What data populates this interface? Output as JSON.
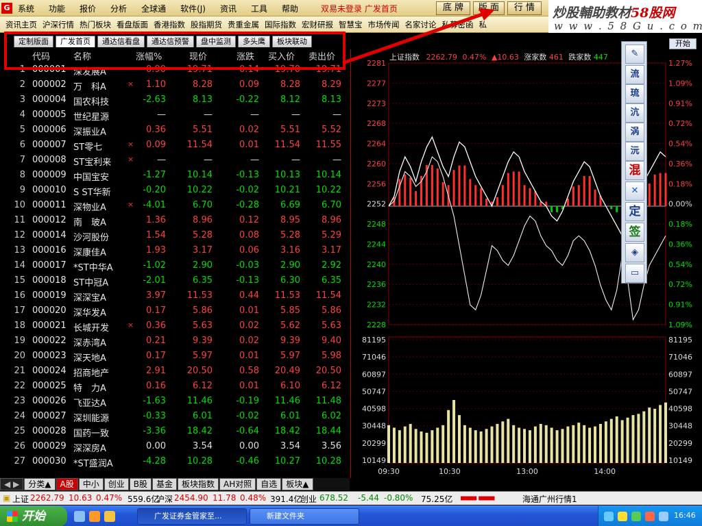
{
  "menubar": {
    "items": [
      "系统",
      "功能",
      "报价",
      "分析",
      "全球通",
      "软件(J)",
      "资讯",
      "工具",
      "帮助"
    ],
    "login_status": "双易未登录 广发首页",
    "buttons": [
      "底 牌",
      "版 面",
      "行 情"
    ]
  },
  "brand": {
    "line1_prefix": "炒股輔助教材",
    "line1_suffix": "58股网",
    "line2": "w w w . 5 8 G u . c o m"
  },
  "linkbar": {
    "items": [
      "资讯主页",
      "沪深行情",
      "热门板块",
      "看盘版面",
      "香港指数",
      "股指期货",
      "贵重金属",
      "国际指数",
      "宏财研报",
      "智慧宝",
      "市场传闻",
      "名家讨论",
      "私募密函",
      "私"
    ]
  },
  "start_button": "开始",
  "tabs": [
    "定制版面",
    "广发首页",
    "通达信看盘",
    "通达信预警",
    "盘中监测",
    "多头鹰",
    "板块联动"
  ],
  "active_tab": "广发首页",
  "table": {
    "headers": {
      "code": "代码",
      "name": "名称",
      "pct": "涨幅%",
      "price": "现价",
      "chg": "涨跌",
      "buy": "买入价",
      "sell": "卖出价"
    },
    "rows": [
      {
        "no": "1",
        "code": "000001",
        "name": "深发展A",
        "x": "",
        "pct": "0.90",
        "price": "19.71",
        "chg": "0.14",
        "buy": "19.70",
        "sell": "19.71",
        "dir": "red"
      },
      {
        "no": "2",
        "code": "000002",
        "name": "万　科A",
        "x": "×",
        "pct": "1.10",
        "price": "8.28",
        "chg": "0.09",
        "buy": "8.28",
        "sell": "8.29",
        "dir": "red"
      },
      {
        "no": "3",
        "code": "000004",
        "name": "国农科技",
        "x": "",
        "pct": "-2.63",
        "price": "8.13",
        "chg": "-0.22",
        "buy": "8.12",
        "sell": "8.13",
        "dir": "grn"
      },
      {
        "no": "4",
        "code": "000005",
        "name": "世纪星源",
        "x": "",
        "pct": "—",
        "price": "—",
        "chg": "—",
        "buy": "—",
        "sell": "—",
        "dir": "wht"
      },
      {
        "no": "5",
        "code": "000006",
        "name": "深振业A",
        "x": "",
        "pct": "0.36",
        "price": "5.51",
        "chg": "0.02",
        "buy": "5.51",
        "sell": "5.52",
        "dir": "red"
      },
      {
        "no": "6",
        "code": "000007",
        "name": "ST零七",
        "x": "×",
        "pct": "0.09",
        "price": "11.54",
        "chg": "0.01",
        "buy": "11.54",
        "sell": "11.55",
        "dir": "red"
      },
      {
        "no": "7",
        "code": "000008",
        "name": "ST宝利来",
        "x": "×",
        "pct": "—",
        "price": "—",
        "chg": "—",
        "buy": "—",
        "sell": "—",
        "dir": "wht"
      },
      {
        "no": "8",
        "code": "000009",
        "name": "中国宝安",
        "x": "",
        "pct": "-1.27",
        "price": "10.14",
        "chg": "-0.13",
        "buy": "10.13",
        "sell": "10.14",
        "dir": "grn"
      },
      {
        "no": "9",
        "code": "000010",
        "name": "S ST华新",
        "x": "",
        "pct": "-0.20",
        "price": "10.22",
        "chg": "-0.02",
        "buy": "10.21",
        "sell": "10.22",
        "dir": "grn"
      },
      {
        "no": "10",
        "code": "000011",
        "name": "深物业A",
        "x": "×",
        "pct": "-4.01",
        "price": "6.70",
        "chg": "-0.28",
        "buy": "6.69",
        "sell": "6.70",
        "dir": "grn"
      },
      {
        "no": "11",
        "code": "000012",
        "name": "南　玻A",
        "x": "",
        "pct": "1.36",
        "price": "8.96",
        "chg": "0.12",
        "buy": "8.95",
        "sell": "8.96",
        "dir": "red"
      },
      {
        "no": "12",
        "code": "000014",
        "name": "沙河股份",
        "x": "",
        "pct": "1.54",
        "price": "5.28",
        "chg": "0.08",
        "buy": "5.28",
        "sell": "5.29",
        "dir": "red"
      },
      {
        "no": "13",
        "code": "000016",
        "name": "深康佳A",
        "x": "",
        "pct": "1.93",
        "price": "3.17",
        "chg": "0.06",
        "buy": "3.16",
        "sell": "3.17",
        "dir": "red"
      },
      {
        "no": "14",
        "code": "000017",
        "name": "*ST中华A",
        "x": "",
        "pct": "-1.02",
        "price": "2.90",
        "chg": "-0.03",
        "buy": "2.90",
        "sell": "2.92",
        "dir": "grn"
      },
      {
        "no": "15",
        "code": "000018",
        "name": "ST中冠A",
        "x": "",
        "pct": "-2.01",
        "price": "6.35",
        "chg": "-0.13",
        "buy": "6.30",
        "sell": "6.35",
        "dir": "grn"
      },
      {
        "no": "16",
        "code": "000019",
        "name": "深深宝A",
        "x": "",
        "pct": "3.97",
        "price": "11.53",
        "chg": "0.44",
        "buy": "11.53",
        "sell": "11.54",
        "dir": "red"
      },
      {
        "no": "17",
        "code": "000020",
        "name": "深华发A",
        "x": "",
        "pct": "0.17",
        "price": "5.86",
        "chg": "0.01",
        "buy": "5.85",
        "sell": "5.86",
        "dir": "red"
      },
      {
        "no": "18",
        "code": "000021",
        "name": "长城开发",
        "x": "×",
        "pct": "0.36",
        "price": "5.63",
        "chg": "0.02",
        "buy": "5.62",
        "sell": "5.63",
        "dir": "red"
      },
      {
        "no": "19",
        "code": "000022",
        "name": "深赤湾A",
        "x": "",
        "pct": "0.21",
        "price": "9.39",
        "chg": "0.02",
        "buy": "9.39",
        "sell": "9.40",
        "dir": "red"
      },
      {
        "no": "20",
        "code": "000023",
        "name": "深天地A",
        "x": "",
        "pct": "0.17",
        "price": "5.97",
        "chg": "0.01",
        "buy": "5.97",
        "sell": "5.98",
        "dir": "red"
      },
      {
        "no": "21",
        "code": "000024",
        "name": "招商地产",
        "x": "",
        "pct": "2.91",
        "price": "20.50",
        "chg": "0.58",
        "buy": "20.49",
        "sell": "20.50",
        "dir": "red"
      },
      {
        "no": "22",
        "code": "000025",
        "name": "特　力A",
        "x": "",
        "pct": "0.16",
        "price": "6.12",
        "chg": "0.01",
        "buy": "6.10",
        "sell": "6.12",
        "dir": "red"
      },
      {
        "no": "23",
        "code": "000026",
        "name": "飞亚达A",
        "x": "",
        "pct": "-1.63",
        "price": "11.46",
        "chg": "-0.19",
        "buy": "11.46",
        "sell": "11.48",
        "dir": "grn"
      },
      {
        "no": "24",
        "code": "000027",
        "name": "深圳能源",
        "x": "",
        "pct": "-0.33",
        "price": "6.01",
        "chg": "-0.02",
        "buy": "6.01",
        "sell": "6.02",
        "dir": "grn"
      },
      {
        "no": "25",
        "code": "000028",
        "name": "国药一致",
        "x": "",
        "pct": "-3.36",
        "price": "18.42",
        "chg": "-0.64",
        "buy": "18.42",
        "sell": "18.44",
        "dir": "grn"
      },
      {
        "no": "26",
        "code": "000029",
        "name": "深深房A",
        "x": "",
        "pct": "0.00",
        "price": "3.54",
        "chg": "0.00",
        "buy": "3.54",
        "sell": "3.56",
        "dir": "wht"
      },
      {
        "no": "27",
        "code": "000030",
        "name": "*ST盛润A",
        "x": "",
        "pct": "-4.28",
        "price": "10.28",
        "chg": "-0.46",
        "buy": "10.27",
        "sell": "10.28",
        "dir": "grn"
      }
    ]
  },
  "bottom_tabs": [
    "分类▲",
    "A股",
    "中小",
    "创业",
    "B股",
    "基金",
    "板块指数",
    "AH对照",
    "自选",
    "板块▲"
  ],
  "bottom_active": "A股",
  "chart_title": {
    "name": "上证指数",
    "value": "2262.79",
    "pct": "0.47%",
    "chg": "▲10.63",
    "up_label": "涨家数",
    "up": "461",
    "down_label": "跌家数",
    "down": "447"
  },
  "chart_data": {
    "type": "line",
    "price_ticks": [
      "2281",
      "2277",
      "2273",
      "2268",
      "2264",
      "2260",
      "2256",
      "2252",
      "2248",
      "2244",
      "2240",
      "2236",
      "2232",
      "2228"
    ],
    "pct_ticks": [
      "1.27%",
      "1.09%",
      "0.91%",
      "0.72%",
      "0.54%",
      "0.36%",
      "0.18%",
      "0.00%",
      "0.18%",
      "0.36%",
      "0.54%",
      "0.72%",
      "0.91%",
      "1.09%"
    ],
    "volume_ticks": [
      "81195",
      "71046",
      "60897",
      "50747",
      "40598",
      "30448",
      "20299",
      "10149"
    ],
    "time_ticks": [
      "09:30",
      "10:30",
      "13:00",
      "14:00"
    ],
    "ylim": [
      2228,
      2281
    ],
    "base": 2252,
    "index_line": [
      2252,
      2254,
      2259,
      2262,
      2260,
      2257,
      2261,
      2264,
      2266,
      2263,
      2260,
      2258,
      2262,
      2265,
      2264,
      2261,
      2258,
      2256,
      2254,
      2252,
      2255,
      2258,
      2261,
      2263,
      2262,
      2259,
      2257,
      2255,
      2253,
      2252,
      2250,
      2249,
      2251,
      2254,
      2257,
      2259,
      2261,
      2260,
      2257,
      2254,
      2252,
      2250,
      2248,
      2246,
      2249,
      2252,
      2255,
      2257,
      2259,
      2261,
      2263,
      2262
    ],
    "avg_line": [
      2252,
      2253,
      2256,
      2259,
      2258,
      2256,
      2257,
      2259,
      2262,
      2261,
      2258,
      2254,
      2250,
      2244,
      2238,
      2232,
      2231,
      2234,
      2239,
      2244,
      2243,
      2241,
      2240,
      2242,
      2245,
      2248,
      2250,
      2249,
      2246,
      2244,
      2243,
      2241,
      2240,
      2242,
      2245,
      2246,
      2245,
      2243,
      2240,
      2236,
      2233,
      2231,
      2235,
      2242,
      2237,
      2229,
      2231,
      2236,
      2240,
      2242,
      2244,
      2246
    ],
    "volume": [
      30,
      28,
      26,
      29,
      31,
      27,
      25,
      24,
      26,
      28,
      30,
      42,
      50,
      38,
      30,
      28,
      26,
      25,
      27,
      29,
      31,
      33,
      35,
      30,
      28,
      27,
      26,
      29,
      31,
      30,
      28,
      26,
      27,
      29,
      30,
      32,
      30,
      28,
      29,
      31,
      33,
      35,
      37,
      34,
      36,
      38,
      39,
      41,
      44,
      43,
      46,
      48
    ]
  },
  "statusbar": {
    "sh_label": "上证",
    "sh_value": "2262.79",
    "sh_chg": "10.63",
    "sh_pct": "0.47%",
    "sh_amount": "559.6亿",
    "sz_label": "沪深",
    "sz_value": "2454.90",
    "sz_chg": "11.78",
    "sz_pct": "0.48%",
    "sz_amount": "391.4亿",
    "cy_label": "创业",
    "cy_value": "678.52",
    "cy_chg": "-5.44",
    "cy_pct": "-0.80%",
    "cy_amount": "75.25亿",
    "server": "海通广州行情1"
  },
  "taskbar": {
    "start": "开始",
    "tasks": [
      "广发证券金管家至...",
      "新建文件夹"
    ],
    "clock": "16:46"
  },
  "toolbar_glyphs": [
    "流",
    "琉",
    "沆",
    "涡",
    "沅",
    "混",
    "定",
    "签"
  ]
}
